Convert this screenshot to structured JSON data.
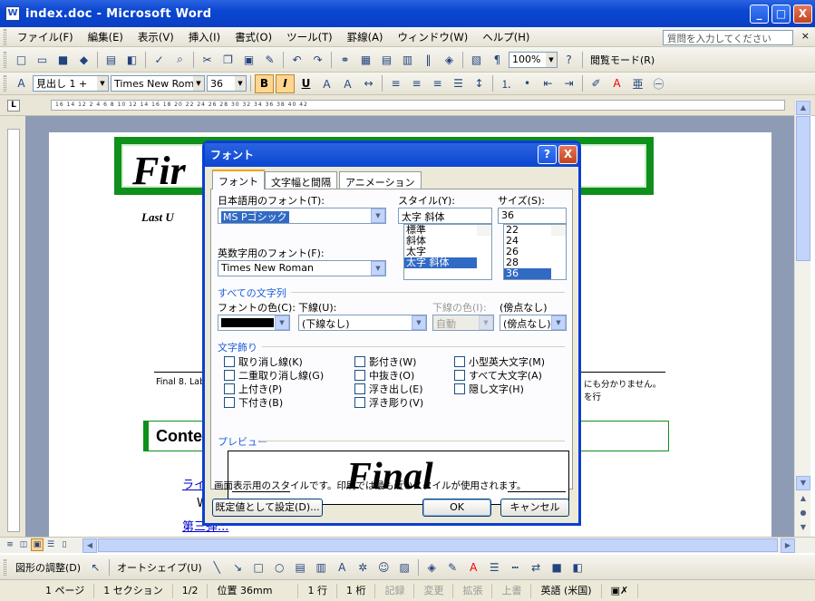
{
  "window": {
    "title": "index.doc - Microsoft Word",
    "min_label": "_",
    "max_label": "□",
    "close_label": "X"
  },
  "menu": [
    "ファイル(F)",
    "編集(E)",
    "表示(V)",
    "挿入(I)",
    "書式(O)",
    "ツール(T)",
    "罫線(A)",
    "ウィンドウ(W)",
    "ヘルプ(H)"
  ],
  "help_placeholder": "質問を入力してください",
  "toolbar": {
    "zoom": "100%",
    "reading_mode": "閲覧モード(R)",
    "style": "見出し 1 + ",
    "font": "Times New Roma",
    "size": "36",
    "bold": "B",
    "italic": "I",
    "underline": "U"
  },
  "ruler": {
    "ticks": "16 14 12 2 4 6 8 10 12 14 16 18 20 22 24 26 28 30 32 34 36 38 40 42"
  },
  "document": {
    "banner_text": "Fir",
    "last_updated": "Last U",
    "footer_left": "Final 8. Lab",
    "footer_right1": "にも分かりません。",
    "footer_right2": "を行",
    "contents_heading": "Conte",
    "link1": "ライ",
    "link2": "W",
    "link3": "第三弾..."
  },
  "dialog": {
    "title": "フォント",
    "help": "?",
    "close": "X",
    "tabs": [
      "フォント",
      "文字幅と間隔",
      "アニメーション"
    ],
    "jp_font_label": "日本語用のフォント(T):",
    "jp_font_value": "MS Pゴシック",
    "en_font_label": "英数字用のフォント(F):",
    "en_font_value": "Times New Roman",
    "style_label": "スタイル(Y):",
    "style_value": "太字 斜体",
    "style_options": [
      "標準",
      "斜体",
      "太字",
      "太字 斜体"
    ],
    "size_label": "サイズ(S):",
    "size_value": "36",
    "size_options": [
      "22",
      "24",
      "26",
      "28",
      "36"
    ],
    "all_text_group": "すべての文字列",
    "color_label": "フォントの色(C):",
    "underline_label": "下線(U):",
    "underline_value": "(下線なし)",
    "underline_color_label": "下線の色(I):",
    "underline_color_value": "自動",
    "emphasis_label": "傍点(;)",
    "emphasis_value": "(傍点なし)",
    "effects_group": "文字飾り",
    "effects": [
      "取り消し線(K)",
      "二重取り消し線(G)",
      "上付き(P)",
      "下付き(B)",
      "影付き(W)",
      "中抜き(O)",
      "浮き出し(E)",
      "浮き彫り(V)",
      "小型英大文字(M)",
      "すべて大文字(A)",
      "隠し文字(H)"
    ],
    "preview_label": "プレビュー",
    "preview_text": "Final",
    "preview_note": "画面表示用のスタイルです。印刷では最も近いスタイルが使用されます。",
    "default_button": "既定値として設定(D)...",
    "ok_button": "OK",
    "cancel_button": "キャンセル"
  },
  "drawbar": {
    "adjust": "図形の調整(D)",
    "autoshape": "オートシェイプ(U)"
  },
  "status": {
    "page": "1 ページ",
    "section": "1 セクション",
    "pages": "1/2",
    "position": "位置 36mm",
    "line": "1 行",
    "column": "1 桁",
    "rec": "記録",
    "trk": "変更",
    "ext": "拡張",
    "ovr": "上書",
    "lang": "英語 (米国)"
  },
  "colors": {
    "accent_green": "#0f8f1b",
    "titlebar_blue": "#0a46d1",
    "font_color": "#000000"
  }
}
